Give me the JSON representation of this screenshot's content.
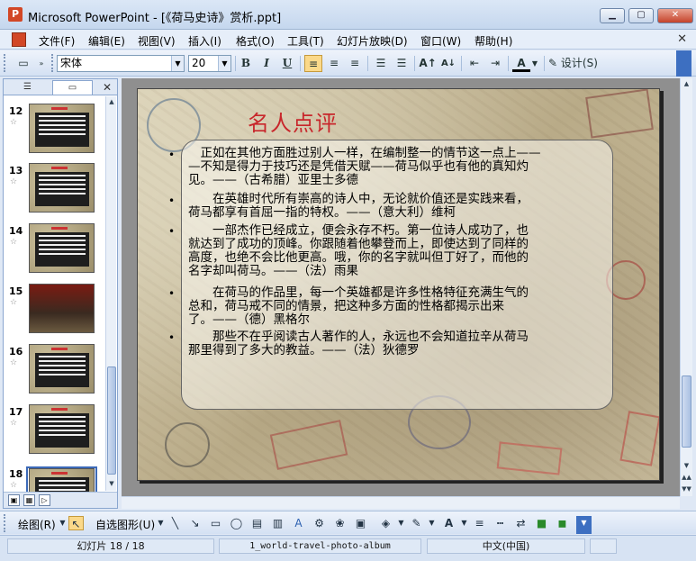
{
  "window": {
    "title": "Microsoft PowerPoint - [《荷马史诗》赏析.ppt]",
    "minimize": "▁",
    "maximize": "▢",
    "close": "✕"
  },
  "menu": {
    "items": [
      "文件(F)",
      "编辑(E)",
      "视图(V)",
      "插入(I)",
      "格式(O)",
      "工具(T)",
      "幻灯片放映(D)",
      "窗口(W)",
      "帮助(H)"
    ],
    "close": "✕"
  },
  "toolbar": {
    "font_name": "宋体",
    "font_size": "20",
    "bold": "B",
    "italic": "I",
    "underline": "U",
    "design_label": "设计(S)"
  },
  "left_pane": {
    "close": "✕",
    "slides": [
      {
        "number": "12",
        "star": "☆"
      },
      {
        "number": "13",
        "star": "☆"
      },
      {
        "number": "14",
        "star": "☆"
      },
      {
        "number": "15",
        "star": "☆"
      },
      {
        "number": "16",
        "star": "☆"
      },
      {
        "number": "17",
        "star": "☆"
      },
      {
        "number": "18",
        "star": "☆"
      }
    ]
  },
  "slide": {
    "title": "名人点评",
    "bullets": [
      "•",
      "•",
      "•",
      "•",
      "•"
    ],
    "paragraphs": [
      [
        "　正如在其他方面胜过别人一样，在编制整一的情节这一点上——",
        "—不知是得力于技巧还是凭借天赋——荷马似乎也有他的真知灼",
        "见。——（古希腊）亚里士多德"
      ],
      [
        "　　在英雄时代所有崇高的诗人中，无论就价值还是实践来看，",
        "荷马都享有首屈一指的特权。——（意大利）维柯"
      ],
      [
        "　　一部杰作已经成立，便会永存不朽。第一位诗人成功了，也",
        "就达到了成功的顶峰。你跟随着他攀登而上，即使达到了同样的",
        "高度，也绝不会比他更高。哦，你的名字就叫但丁好了，而他的",
        "名字却叫荷马。——（法）雨果"
      ],
      [
        "　　在荷马的作品里，每一个英雄都是许多性格特征充满生气的",
        "总和，荷马戒不同的情景，把这种多方面的性格都揭示出来",
        "了。——（德）黑格尔"
      ],
      [
        "　　那些不在乎阅读古人著作的人，永远也不会知道拉辛从荷马",
        "那里得到了多大的教益。——（法）狄德罗"
      ]
    ]
  },
  "drawing_toolbar": {
    "draw_label": "绘图(R)",
    "autoshape_label": "自选图形(U)"
  },
  "status": {
    "slide_indicator": "幻灯片 18 / 18",
    "template": "1_world-travel-photo-album",
    "language": "中文(中国)"
  },
  "colors": {
    "title_red": "#c8262b",
    "chrome_blue": "#dfe8f5",
    "selection_blue": "#3c6ab8"
  }
}
